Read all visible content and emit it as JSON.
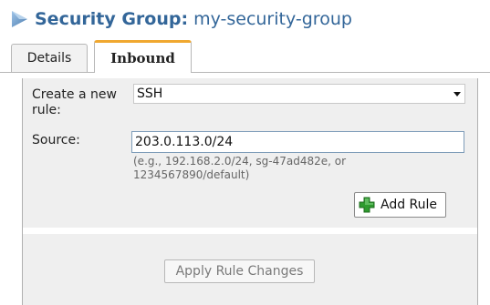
{
  "header": {
    "label": "Security Group:",
    "value": "my-security-group",
    "icon": "triangle-arrow-icon",
    "color": "#336699"
  },
  "tabs": [
    {
      "label": "Details",
      "active": false
    },
    {
      "label": "Inbound",
      "active": true
    }
  ],
  "form": {
    "rule_label": "Create a new rule:",
    "rule_value": "SSH",
    "source_label": "Source:",
    "source_value": "203.0.113.0/24",
    "hint": "(e.g., 192.168.2.0/24, sg-47ad482e, or 1234567890/default)"
  },
  "buttons": {
    "add_rule": "Add Rule",
    "add_rule_icon": "plus-icon",
    "apply": "Apply Rule Changes"
  },
  "colors": {
    "accent_tab": "#f0a830",
    "plus_green": "#2e9b2e",
    "panel_bg": "#efefef"
  }
}
